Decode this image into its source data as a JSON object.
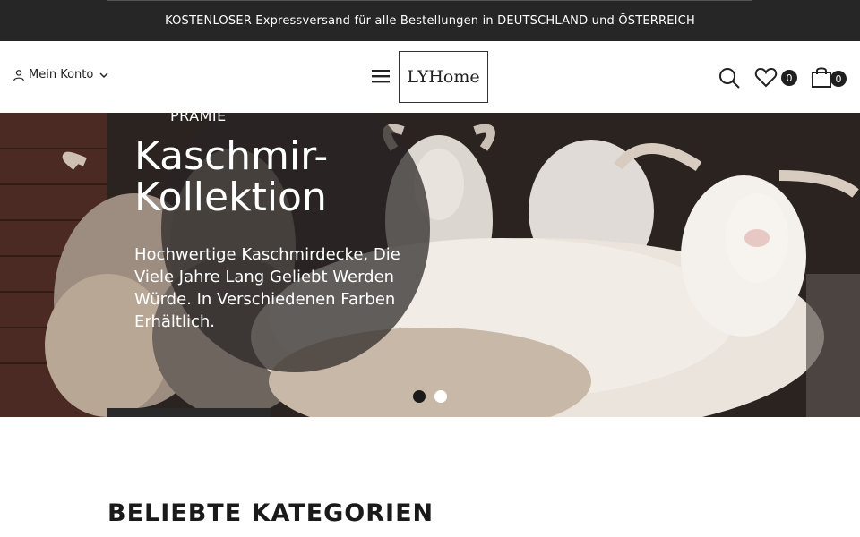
{
  "announcement": {
    "text": "KOSTENLOSER Expressversand für alle Bestellungen in DEUTSCHLAND und ÖSTERREICH"
  },
  "header": {
    "account_label": "Mein Konto",
    "logo_text": "LYHome",
    "wishlist_count": "0",
    "cart_count": "0"
  },
  "hero": {
    "kicker": "PRÄMIE",
    "title": "Kaschmir-Kollektion",
    "description": "Hochwertige Kaschmirdecke, Die Viele Jahre Lang Geliebt Werden Würde. In Verschiedenen Farben Erhältlich.",
    "slides_total": 2,
    "active_slide": 1
  },
  "categories": {
    "title": "BELIEBTE KATEGORIEN"
  },
  "colors": {
    "announcement_bg": "#262626",
    "text_dark": "#1a1a1a",
    "badge_bg": "#1f1f1f"
  }
}
